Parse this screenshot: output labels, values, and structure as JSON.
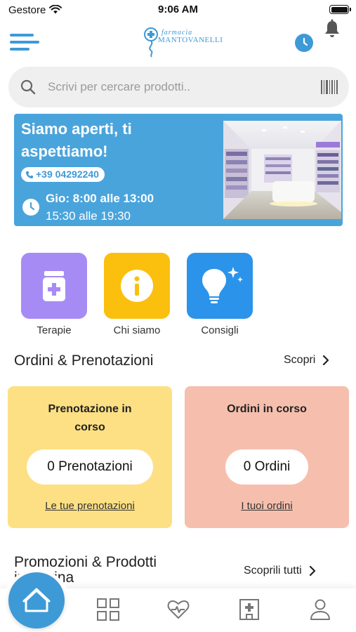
{
  "status_bar": {
    "carrier": "Gestore",
    "time": "9:06 AM"
  },
  "header": {
    "logo_line1": "farmacia",
    "logo_line2": "MANTOVANELLI"
  },
  "search": {
    "placeholder": "Scrivi per cercare prodotti.."
  },
  "hero": {
    "title": "Siamo aperti, ti aspettiamo!",
    "phone": "+39 04292240",
    "hours_line1": "Gio: 8:00 alle 13:00",
    "hours_line2": "15:30 alle 19:30"
  },
  "quick_actions": [
    {
      "label": "Terapie",
      "icon": "medicine-jar-icon",
      "color": "#a78bf5"
    },
    {
      "label": "Chi siamo",
      "icon": "info-icon",
      "color": "#fbbf0d"
    },
    {
      "label": "Consigli",
      "icon": "lightbulb-icon",
      "color": "#2b93ea"
    }
  ],
  "orders_section": {
    "title": "Ordini & Prenotazioni",
    "link": "Scopri"
  },
  "cards": {
    "bookings": {
      "title": "Prenotazione in corso",
      "value": "0 Prenotazioni",
      "link": "Le tue prenotazioni",
      "color": "#fde084"
    },
    "orders": {
      "title": "Ordini in corso",
      "value": "0 Ordini",
      "link": "I tuoi ordini",
      "color": "#f6bfad"
    }
  },
  "promo_section": {
    "title": "Promozioni & Prodotti in vetrina",
    "link": "Scoprili tutti"
  },
  "colors": {
    "accent": "#3d9ad6",
    "hero_bg": "#4aa4dc"
  },
  "tabbar": {
    "items": [
      {
        "icon": "home-icon",
        "active": true
      },
      {
        "icon": "grid-icon"
      },
      {
        "icon": "heart-pulse-icon"
      },
      {
        "icon": "pharmacy-icon"
      },
      {
        "icon": "user-icon"
      }
    ]
  }
}
